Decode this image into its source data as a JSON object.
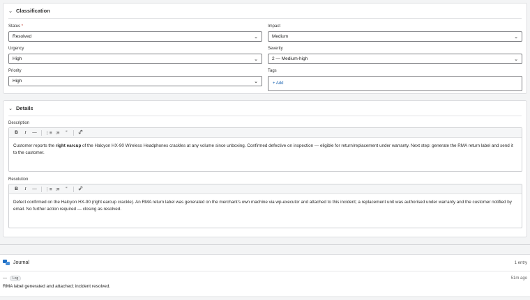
{
  "classification": {
    "title": "Classification",
    "status": {
      "label": "Status",
      "required": "*",
      "value": "Resolved"
    },
    "impact": {
      "label": "Impact",
      "value": "Medium"
    },
    "urgency": {
      "label": "Urgency",
      "value": "High"
    },
    "severity": {
      "label": "Severity",
      "value": "2 — Medium-high"
    },
    "priority": {
      "label": "Priority",
      "value": "High"
    },
    "tags": {
      "label": "Tags",
      "add_label": "+ Add"
    }
  },
  "details": {
    "title": "Details",
    "description": {
      "label": "Description",
      "text_before": "Customer reports the ",
      "text_bold": "right earcup",
      "text_after": " of the Halcyon HX-90 Wireless Headphones crackles at any volume since unboxing. Confirmed defective on inspection — eligible for return/replacement under warranty. Next step: generate the RMA return label and send it to the customer."
    },
    "resolution": {
      "label": "Resolution",
      "text": "Defect confirmed on the Halcyon HX-90 (right earcup crackle). An RMA return label was generated on the merchant's own machine via wp-executor and attached to this incident; a replacement unit was authorised under warranty and the customer notified by email. No further action required — closing as resolved."
    },
    "toolbar": {
      "bold": "B",
      "italic": "I",
      "hr": "—",
      "ol": "⋮≡",
      "ul": "⁝≡",
      "quote": "“",
      "link": "🔗"
    }
  },
  "journal": {
    "title": "Journal",
    "count": "1 entry",
    "entries": [
      {
        "author": "—",
        "type": "Log",
        "time": "51m ago",
        "text": "RMA label generated and attached; incident resolved."
      }
    ]
  },
  "colors": {
    "accent": "#2269b4",
    "required": "#c0392b",
    "icon_blue": "#1f6fc4"
  }
}
